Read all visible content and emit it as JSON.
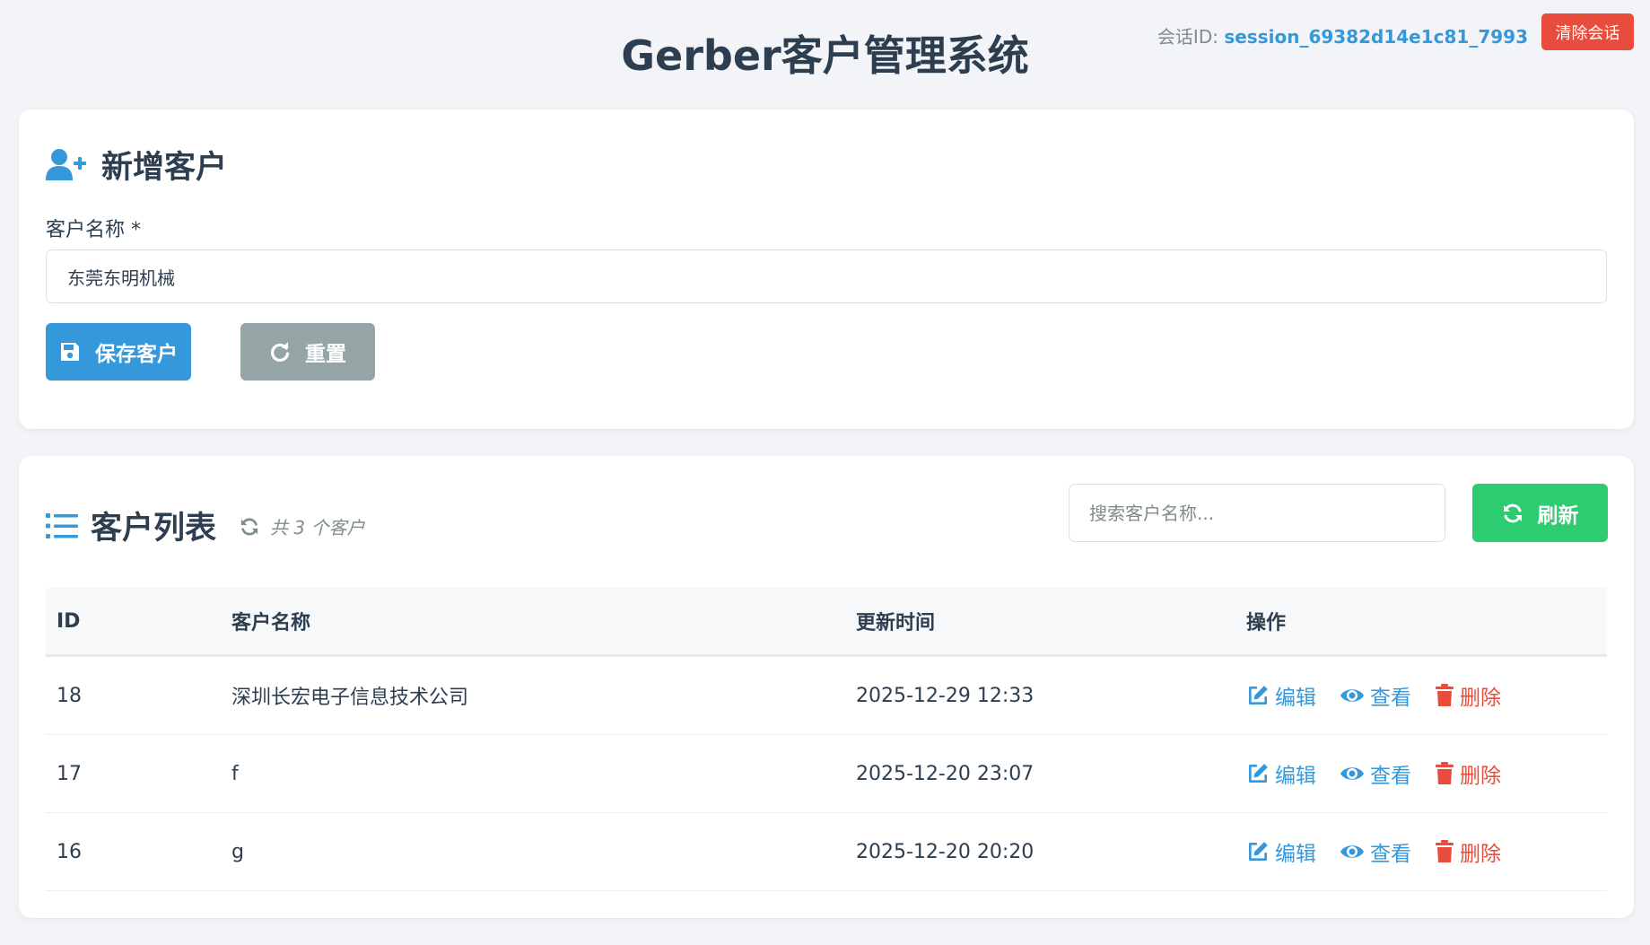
{
  "header": {
    "title": "Gerber客户管理系统",
    "session_label": "会话ID:",
    "session_id": "session_69382d14e1c81_7993",
    "clear_label": "清除会话"
  },
  "add_customer": {
    "title": "新增客户",
    "field_label": "客户名称 *",
    "name_value": "东莞东明机械",
    "save_label": "保存客户",
    "reset_label": "重置"
  },
  "customer_list": {
    "title": "客户列表",
    "count_text": "共 3 个客户",
    "search_placeholder": "搜索客户名称...",
    "refresh_label": "刷新",
    "columns": [
      "ID",
      "客户名称",
      "更新时间",
      "操作"
    ],
    "rows": [
      {
        "id": "18",
        "name": "深圳长宏电子信息技术公司",
        "time": "2025-12-29 12:33"
      },
      {
        "id": "17",
        "name": "f",
        "time": "2025-12-20 23:07"
      },
      {
        "id": "16",
        "name": "g",
        "time": "2025-12-20 20:20"
      }
    ],
    "actions": {
      "edit": "编辑",
      "view": "查看",
      "delete": "删除"
    }
  },
  "colors": {
    "primary": "#3498db",
    "success": "#2ecc71",
    "danger": "#e74c3c",
    "muted": "#95a5a6",
    "text": "#2c3e50"
  }
}
